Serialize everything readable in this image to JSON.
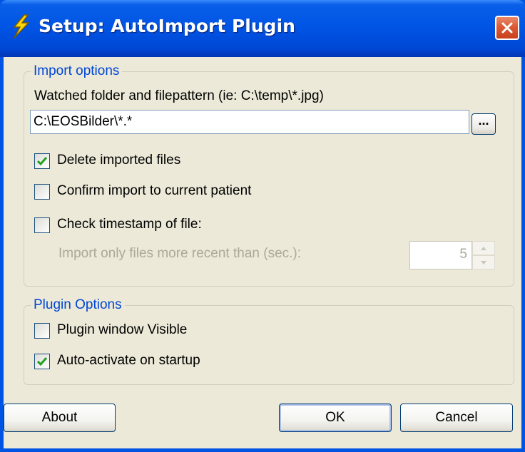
{
  "window": {
    "title": "Setup: AutoImport Plugin"
  },
  "import_options": {
    "group_label": "Import options",
    "folder_label": "Watched folder and filepattern (ie: C:\\temp\\*.jpg)",
    "folder_value": "C:\\EOSBilder\\*.*",
    "browse_label": "...",
    "delete_imported": {
      "label": "Delete imported files",
      "checked": true
    },
    "confirm_import": {
      "label": "Confirm import to current patient",
      "checked": false
    },
    "check_timestamp": {
      "label": "Check timestamp of file:",
      "checked": false
    },
    "recent_label": "Import only files more recent than (sec.):",
    "recent_value": "5"
  },
  "plugin_options": {
    "group_label": "Plugin Options",
    "window_visible": {
      "label": "Plugin window Visible",
      "checked": false
    },
    "auto_activate": {
      "label": "Auto-activate on startup",
      "checked": true
    }
  },
  "buttons": {
    "about": "About",
    "ok": "OK",
    "cancel": "Cancel"
  },
  "icons": {
    "title_icon": "lightning-bolt-icon",
    "close_icon": "close-icon",
    "check_icon": "checkmark-icon",
    "spin_up_icon": "spin-up-arrow-icon",
    "spin_down_icon": "spin-down-arrow-icon"
  },
  "colors": {
    "titlebar": "#0055e5",
    "client_bg": "#ece9d8",
    "group_label": "#0046d5",
    "check_green": "#21a121",
    "disabled_text": "#aca899"
  }
}
